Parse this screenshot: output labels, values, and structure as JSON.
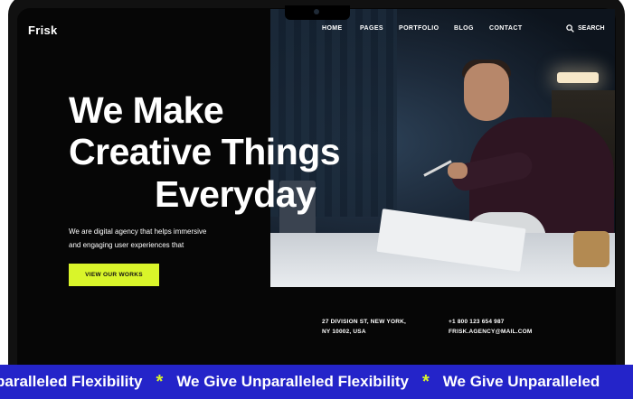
{
  "brand": {
    "name": "Frisk"
  },
  "nav": {
    "items": [
      "HOME",
      "PAGES",
      "PORTFOLIO",
      "BLOG",
      "CONTACT"
    ],
    "search_label": "SEARCH"
  },
  "hero": {
    "headline": [
      "We Make",
      "Creative Things",
      "Everyday"
    ],
    "description": [
      "We are digital agency that helps immersive",
      "and engaging user experiences that"
    ],
    "cta_label": "VIEW OUR WORKS"
  },
  "contact": {
    "address": [
      "27 DIVISION ST, NEW YORK,",
      "NY 10002, USA"
    ],
    "phone": "+1 800 123 654 987",
    "email": "FRISK.AGENCY@MAIL.COM"
  },
  "ticker": {
    "items": [
      "paralleled Flexibility",
      "We Give Unparalleled Flexibility",
      "We Give Unparalleled"
    ],
    "separator": "*"
  },
  "colors": {
    "accent": "#d9f52a",
    "banner": "#2424c9",
    "background": "#060606"
  }
}
